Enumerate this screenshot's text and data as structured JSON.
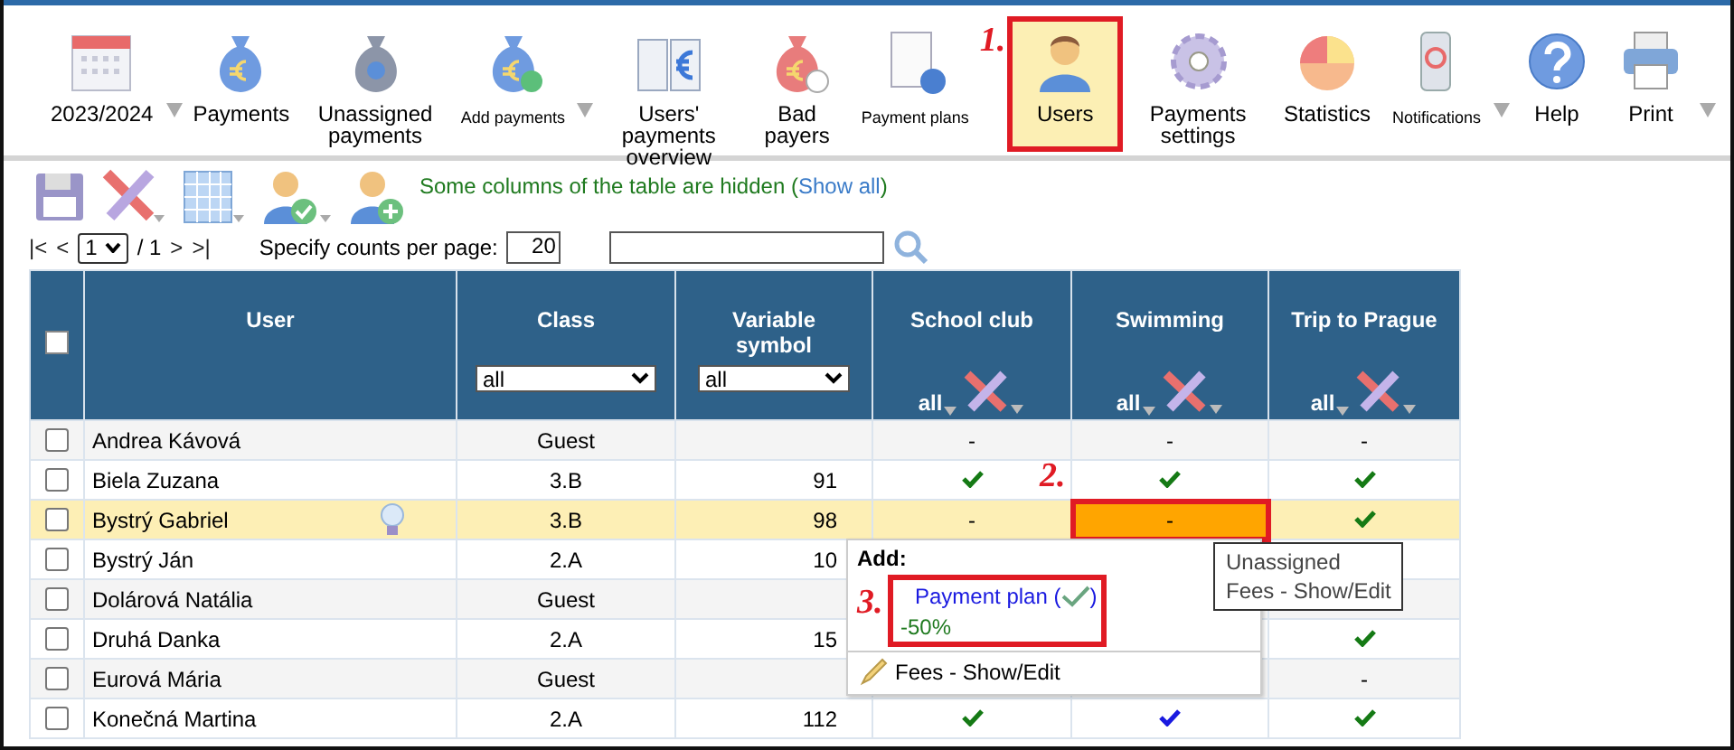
{
  "toolbar": [
    {
      "label": "2023/2024",
      "dropdown": true,
      "selected": false
    },
    {
      "label": "Payments",
      "dropdown": false,
      "selected": false
    },
    {
      "label": "Unassigned payments",
      "dropdown": false,
      "selected": false
    },
    {
      "label": "Add payments",
      "dropdown": true,
      "selected": false
    },
    {
      "label": "Users' payments overview",
      "dropdown": false,
      "selected": false
    },
    {
      "label": "Bad payers",
      "dropdown": false,
      "selected": false
    },
    {
      "label": "Payment plans",
      "dropdown": false,
      "selected": false
    },
    {
      "label": "Users",
      "dropdown": false,
      "selected": true,
      "callout": "1."
    },
    {
      "label": "Payments settings",
      "dropdown": false,
      "selected": false
    },
    {
      "label": "Statistics",
      "dropdown": false,
      "selected": false
    },
    {
      "label": "Notifications",
      "dropdown": true,
      "selected": false
    },
    {
      "label": "Help",
      "dropdown": false,
      "selected": false
    },
    {
      "label": "Print",
      "dropdown": true,
      "selected": false
    }
  ],
  "notice": {
    "text": "Some columns of the table are hidden (",
    "link": "Show all",
    "tail": ")"
  },
  "pager": {
    "first": "|<",
    "prev": "<",
    "page": "1",
    "total": "/ 1",
    "next": ">",
    "last": ">|",
    "per_page_label": "Specify counts per page:",
    "per_page": "20"
  },
  "table": {
    "all_checked": false,
    "columns": [
      {
        "label": "User",
        "kind": "plain"
      },
      {
        "label": "Class",
        "kind": "select",
        "value": "all"
      },
      {
        "label": "Variable symbol",
        "kind": "select",
        "value": "all"
      },
      {
        "label": "School club",
        "kind": "service",
        "value": "all"
      },
      {
        "label": "Swimming",
        "kind": "service",
        "value": "all"
      },
      {
        "label": "Trip to Prague",
        "kind": "service",
        "value": "all"
      }
    ],
    "rows": [
      {
        "user": "Andrea Kávová",
        "class": "Guest",
        "vs": "",
        "selected": false,
        "checked": false,
        "hint": false,
        "services": [
          {
            "kind": "text",
            "text": "-"
          },
          {
            "kind": "text",
            "text": "-"
          },
          {
            "kind": "text",
            "text": "-"
          }
        ]
      },
      {
        "user": "Biela Zuzana",
        "class": "3.B",
        "vs": "91",
        "selected": false,
        "checked": false,
        "hint": false,
        "services": [
          {
            "kind": "check",
            "color": "#157a15"
          },
          {
            "kind": "check",
            "color": "#157a15"
          },
          {
            "kind": "check",
            "color": "#157a15"
          }
        ]
      },
      {
        "user": "Bystrý Gabriel",
        "class": "3.B",
        "vs": "98",
        "selected": true,
        "checked": false,
        "hint": true,
        "services": [
          {
            "kind": "text",
            "text": "-"
          },
          {
            "kind": "text",
            "text": "-",
            "highlighted": true,
            "callout": "2."
          },
          {
            "kind": "check",
            "color": "#157a15"
          }
        ]
      },
      {
        "user": "Bystrý Ján",
        "class": "2.A",
        "vs": "10",
        "selected": false,
        "checked": false,
        "hint": false,
        "services": [
          {
            "kind": "covered"
          },
          {
            "kind": "covered"
          },
          {
            "kind": "covered"
          }
        ]
      },
      {
        "user": "Dolárová Natália",
        "class": "Guest",
        "vs": "",
        "selected": false,
        "checked": false,
        "hint": false,
        "services": [
          {
            "kind": "covered"
          },
          {
            "kind": "covered"
          },
          {
            "kind": "covered"
          }
        ]
      },
      {
        "user": "Druhá Danka",
        "class": "2.A",
        "vs": "15",
        "selected": false,
        "checked": false,
        "hint": false,
        "services": [
          {
            "kind": "covered"
          },
          {
            "kind": "covered"
          },
          {
            "kind": "check",
            "color": "#157a15"
          }
        ]
      },
      {
        "user": "Eurová Mária",
        "class": "Guest",
        "vs": "",
        "selected": false,
        "checked": false,
        "hint": false,
        "services": [
          {
            "kind": "covered"
          },
          {
            "kind": "covered"
          },
          {
            "kind": "text",
            "text": "-"
          }
        ]
      },
      {
        "user": "Konečná Martina",
        "class": "2.A",
        "vs": "112",
        "selected": false,
        "checked": false,
        "hint": false,
        "services": [
          {
            "kind": "check",
            "color": "#157a15"
          },
          {
            "kind": "check",
            "color": "#1a1ae0"
          },
          {
            "kind": "check",
            "color": "#157a15"
          }
        ]
      }
    ]
  },
  "popup": {
    "title": "Add:",
    "plan": {
      "text": "Payment plan (",
      "tail": ")",
      "callout": "3."
    },
    "discount": "-50%",
    "fees": "Fees - Show/Edit"
  },
  "tooltip": {
    "lines": [
      "Unassigned",
      "Fees - Show/Edit"
    ]
  }
}
